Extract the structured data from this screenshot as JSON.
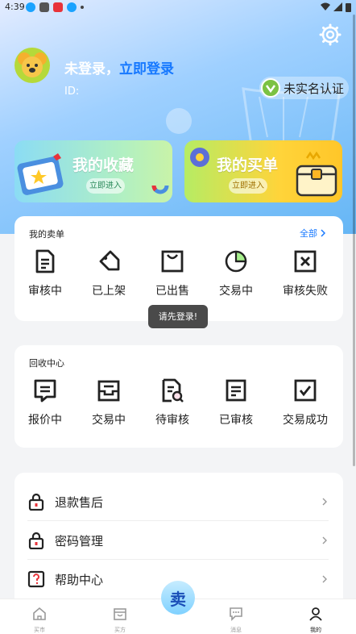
{
  "status_bar": {
    "time": "4:39"
  },
  "header": {
    "login_prefix": "未登录，",
    "login_link": "立即登录",
    "id_label": "ID:",
    "verify_label": "未实名认证"
  },
  "banners": {
    "favorites": {
      "title": "我的收藏",
      "button": "立即进入"
    },
    "my_buys": {
      "title": "我的买单",
      "button": "立即进入"
    }
  },
  "sell_orders": {
    "title": "我的卖单",
    "all_link": "全部",
    "items": [
      {
        "label": "审核中",
        "icon": "document-lines-icon"
      },
      {
        "label": "已上架",
        "icon": "tag-icon"
      },
      {
        "label": "已出售",
        "icon": "shopping-bag-icon"
      },
      {
        "label": "交易中",
        "icon": "pie-chart-icon"
      },
      {
        "label": "审核失败",
        "icon": "x-box-icon"
      }
    ]
  },
  "toast": {
    "text": "请先登录!"
  },
  "recycle": {
    "title": "回收中心",
    "items": [
      {
        "label": "报价中",
        "icon": "quote-bubble-icon"
      },
      {
        "label": "交易中",
        "icon": "inbox-tray-icon"
      },
      {
        "label": "待审核",
        "icon": "document-search-icon"
      },
      {
        "label": "已审核",
        "icon": "document-check-icon"
      },
      {
        "label": "交易成功",
        "icon": "check-box-icon"
      }
    ]
  },
  "menu": [
    {
      "label": "退款售后",
      "icon": "lock-icon"
    },
    {
      "label": "密码管理",
      "icon": "lock-icon"
    },
    {
      "label": "帮助中心",
      "icon": "question-box-icon"
    }
  ],
  "tabbar": {
    "items": [
      {
        "label": "买市",
        "icon": "home-icon"
      },
      {
        "label": "买方",
        "icon": "store-icon"
      },
      {
        "label": "消息",
        "icon": "message-icon"
      },
      {
        "label": "我的",
        "icon": "user-icon"
      }
    ],
    "fab_label": "卖"
  },
  "colors": {
    "accent": "#1678ff",
    "primary_text": "#222222"
  }
}
